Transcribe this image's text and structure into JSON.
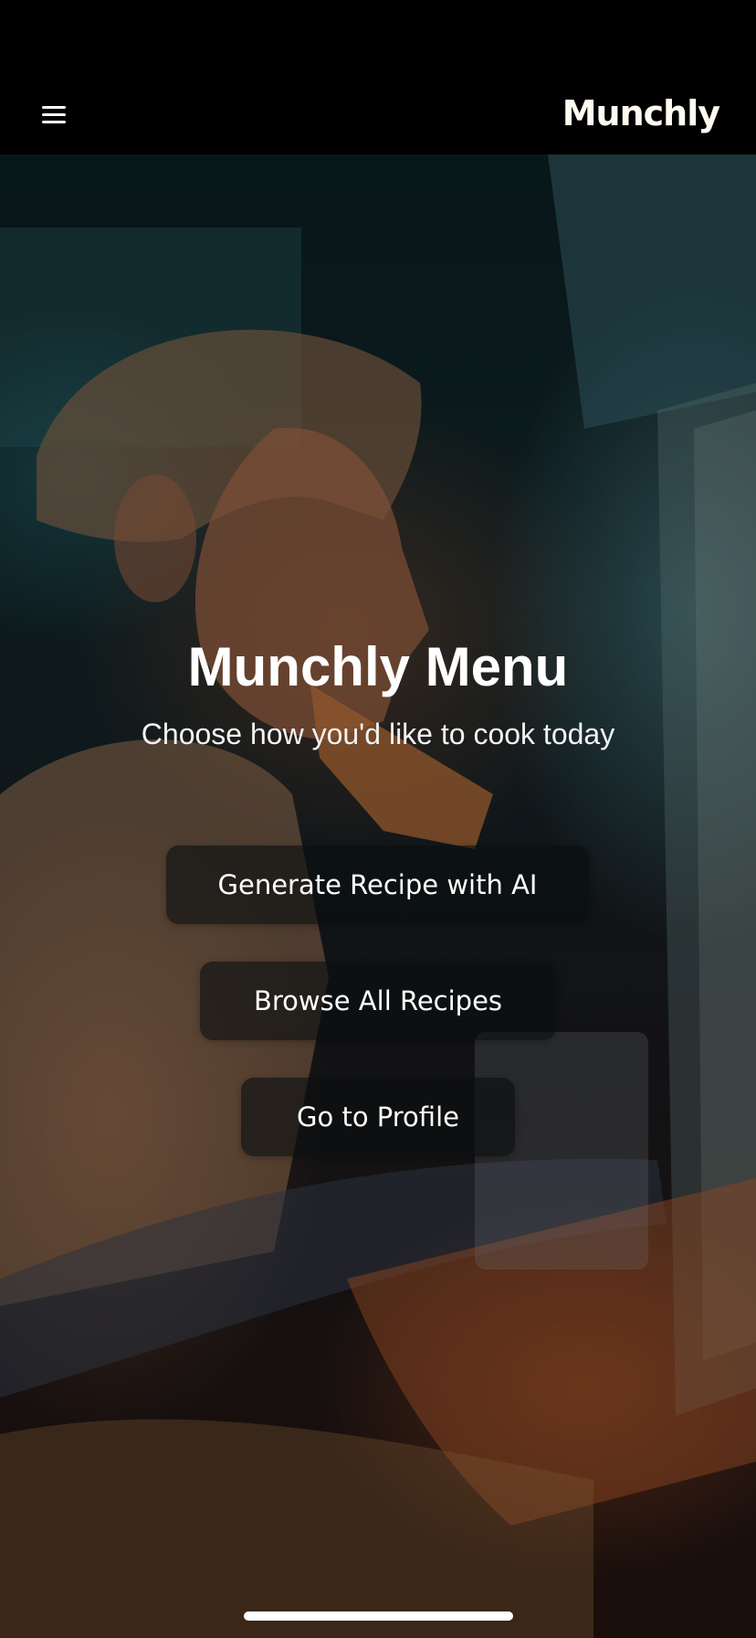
{
  "header": {
    "menu_icon": "hamburger-menu-icon",
    "brand": "Munchly"
  },
  "hero": {
    "image": "illustration of man eating pizza by open fridge at night",
    "title": "Munchly Menu",
    "subtitle": "Choose how you'd like to cook today"
  },
  "actions": {
    "generate_ai": "Generate Recipe with AI",
    "browse_all": "Browse All Recipes",
    "profile": "Go to Profile"
  },
  "colors": {
    "header_bg": "#000000",
    "button_bg": "rgba(10,14,16,0.62)",
    "text": "#ffffff"
  }
}
